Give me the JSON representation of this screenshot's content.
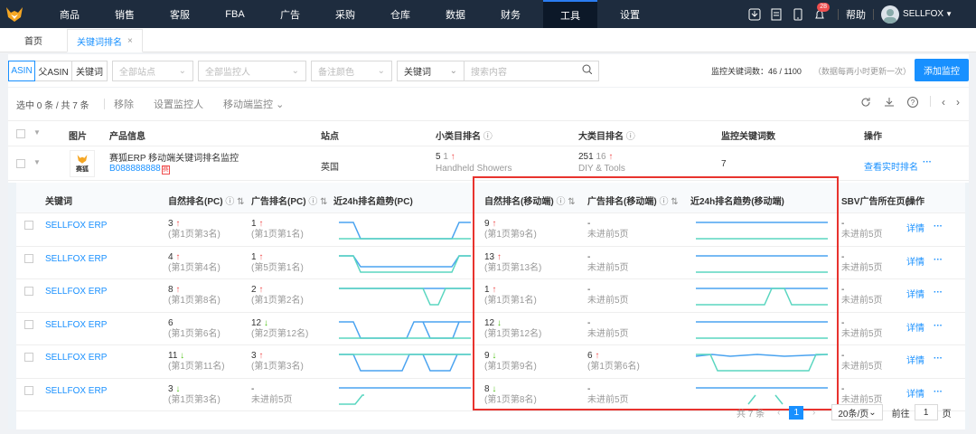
{
  "nav": [
    "商品",
    "销售",
    "客服",
    "FBA",
    "广告",
    "采购",
    "仓库",
    "数据",
    "财务",
    "工具",
    "设置"
  ],
  "nav_active": 9,
  "topright": {
    "badge": "28",
    "help": "帮助",
    "user": "SELLFOX"
  },
  "tabs": {
    "home": "首页",
    "active": "关键词排名",
    "close": "×"
  },
  "filters": {
    "seg": [
      "ASIN",
      "父ASIN",
      "关键词"
    ],
    "site": "全部站点",
    "monitor": "全部监控人",
    "color": "备注颜色",
    "field": "关键词",
    "search_ph": "搜索内容",
    "quota_label": "监控关键词数：46 / 1100",
    "quota_note": "（数据每两小时更新一次）",
    "add": "添加监控"
  },
  "bar": {
    "selected": "选中 0 条 / 共 7 条",
    "remove": "移除",
    "set_monitor": "设置监控人",
    "mobile": "移动端监控"
  },
  "head": {
    "img": "图片",
    "info": "产品信息",
    "site": "站点",
    "small": "小类目排名",
    "big": "大类目排名",
    "count": "监控关键词数",
    "op": "操作"
  },
  "product": {
    "name": "赛狐ERP 移动端关键词排名监控",
    "asin": "B088888888",
    "tag": "赛狐",
    "site": "英国",
    "small_rank": "5",
    "small_delta": "1",
    "small_cat": "Handheld Showers",
    "big_rank": "251",
    "big_delta": "16",
    "big_cat": "DIY & Tools",
    "count": "7",
    "action": "查看实时排名",
    "more": "···"
  },
  "sub_head": {
    "kw": "关键词",
    "pc_nat": "自然排名(PC)",
    "pc_ad": "广告排名(PC)",
    "pc_trend": "近24h排名趋势(PC)",
    "m_nat": "自然排名(移动端)",
    "m_ad": "广告排名(移动端)",
    "m_trend": "近24h排名趋势(移动端)",
    "sbv": "SBV广告所在页(",
    "op": "操作"
  },
  "rows": [
    {
      "kw": "SELLFOX ERP",
      "pcn": "3",
      "pcnd": "up",
      "pcns": "(第1页第3名)",
      "pca": "1",
      "pcad": "up",
      "pcas": "(第1页第1名)",
      "mn": "9",
      "mnd": "up",
      "mns": "(第1页第9名)",
      "ma": "-",
      "mad": "",
      "mas": "未进前5页",
      "sbv": "-",
      "sbvs": "未进前5页",
      "op": "详情",
      "more": "···"
    },
    {
      "kw": "SELLFOX ERP",
      "pcn": "4",
      "pcnd": "up",
      "pcns": "(第1页第4名)",
      "pca": "1",
      "pcad": "up",
      "pcas": "(第5页第1名)",
      "mn": "13",
      "mnd": "up",
      "mns": "(第1页第13名)",
      "ma": "-",
      "mad": "",
      "mas": "未进前5页",
      "sbv": "-",
      "sbvs": "未进前5页",
      "op": "详情",
      "more": "···"
    },
    {
      "kw": "SELLFOX ERP",
      "pcn": "8",
      "pcnd": "up",
      "pcns": "(第1页第8名)",
      "pca": "2",
      "pcad": "up",
      "pcas": "(第1页第2名)",
      "mn": "1",
      "mnd": "up",
      "mns": "(第1页第1名)",
      "ma": "-",
      "mad": "",
      "mas": "未进前5页",
      "sbv": "-",
      "sbvs": "未进前5页",
      "op": "详情",
      "more": "···"
    },
    {
      "kw": "SELLFOX ERP",
      "pcn": "6",
      "pcnd": "",
      "pcns": "(第1页第6名)",
      "pca": "12",
      "pcad": "dn",
      "pcas": "(第2页第12名)",
      "mn": "12",
      "mnd": "dn",
      "mns": "(第1页第12名)",
      "ma": "-",
      "mad": "",
      "mas": "未进前5页",
      "sbv": "-",
      "sbvs": "未进前5页",
      "op": "详情",
      "more": "···"
    },
    {
      "kw": "SELLFOX ERP",
      "pcn": "11",
      "pcnd": "dn",
      "pcns": "(第1页第11名)",
      "pca": "3",
      "pcad": "up",
      "pcas": "(第1页第3名)",
      "mn": "9",
      "mnd": "dn",
      "mns": "(第1页第9名)",
      "ma": "6",
      "mad": "up",
      "mas": "(第1页第6名)",
      "sbv": "-",
      "sbvs": "未进前5页",
      "op": "详情",
      "more": "···"
    },
    {
      "kw": "SELLFOX ERP",
      "pcn": "3",
      "pcnd": "dn",
      "pcns": "(第1页第3名)",
      "pca": "-",
      "pcad": "",
      "pcas": "未进前5页",
      "mn": "8",
      "mnd": "dn",
      "mns": "(第1页第8名)",
      "ma": "-",
      "mad": "",
      "mas": "未进前5页",
      "sbv": "-",
      "sbvs": "未进前5页",
      "op": "详情",
      "more": "···"
    }
  ],
  "pagination": {
    "total": "共 7 条",
    "page": "1",
    "size": "20条/页",
    "goto": "前往",
    "goto_val": "1",
    "unit": "页"
  },
  "colors": {
    "accent": "#1890ff",
    "up": "#f04f4f",
    "down": "#52c41a",
    "highlight": "#e8332e",
    "topbar": "#1e2c3e"
  }
}
